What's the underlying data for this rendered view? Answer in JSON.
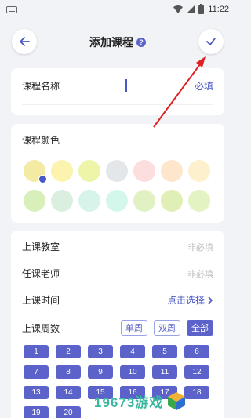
{
  "status": {
    "time": "11:22"
  },
  "header": {
    "title": "添加课程",
    "help_glyph": "?"
  },
  "name_card": {
    "label": "课程名称",
    "required_text": "必填"
  },
  "color_card": {
    "label": "课程颜色",
    "swatches": [
      "#f3eba4",
      "#fbf3ae",
      "#eef5a8",
      "#e4e7ea",
      "#fcdede",
      "#fde6cc",
      "#fdf0cc",
      "#d9efba",
      "#dbefe0",
      "#d6f4ea",
      "#d4f7ec",
      "#e1f1c4",
      "#dfefb6",
      "#e4f3c2"
    ],
    "selected_index": 0
  },
  "details": {
    "classroom_label": "上课教室",
    "classroom_placeholder": "非必填",
    "teacher_label": "任课老师",
    "teacher_placeholder": "非必填",
    "time_label": "上课时间",
    "time_action": "点击选择",
    "weeks_label": "上课周数",
    "week_options": [
      "单周",
      "双周",
      "全部"
    ],
    "week_selected": "全部",
    "weeks": [
      "1",
      "2",
      "3",
      "4",
      "5",
      "6",
      "7",
      "8",
      "9",
      "10",
      "11",
      "12",
      "13",
      "14",
      "15",
      "16",
      "17",
      "18",
      "19",
      "20"
    ]
  },
  "watermark": {
    "text": "19673游戏"
  },
  "colors": {
    "accent": "#5b62c9",
    "arrow": "#e02020"
  }
}
